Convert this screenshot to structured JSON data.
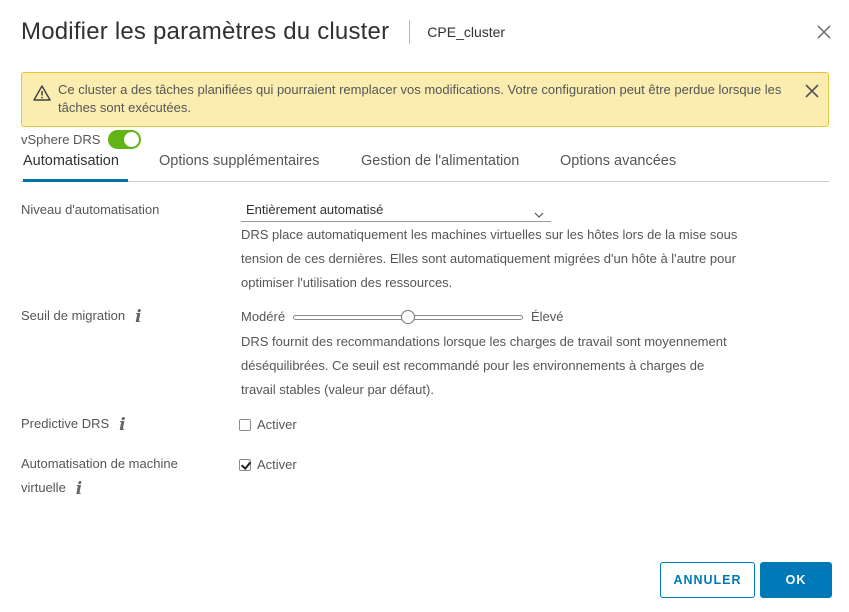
{
  "dialog": {
    "title": "Modifier les paramètres du cluster",
    "subtitle": "CPE_cluster"
  },
  "alert": {
    "message": "Ce cluster a des tâches planifiées qui pourraient remplacer vos modifications. Votre configuration peut être perdue lorsque les tâches sont exécutées."
  },
  "drs": {
    "label": "vSphere DRS",
    "enabled": true
  },
  "tabs": [
    {
      "label": "Automatisation",
      "active": true
    },
    {
      "label": "Options supplémentaires",
      "active": false
    },
    {
      "label": "Gestion de l'alimentation",
      "active": false
    },
    {
      "label": "Options avancées",
      "active": false
    }
  ],
  "form": {
    "automation_level": {
      "label": "Niveau d'automatisation",
      "value": "Entièrement automatisé",
      "description": "DRS place automatiquement les machines virtuelles sur les hôtes lors de la mise sous tension de ces dernières. Elles sont automatiquement migrées d'un hôte à l'autre pour optimiser l'utilisation des ressources."
    },
    "migration_threshold": {
      "label": "Seuil de migration",
      "low_label": "Modéré",
      "high_label": "Élevé",
      "level": 0.5,
      "description": "DRS fournit des recommandations lorsque les charges de travail sont moyennement déséquilibrées. Ce seuil est recommandé pour les environnements à charges de travail stables (valeur par défaut)."
    },
    "predictive_drs": {
      "label": "Predictive DRS",
      "checkbox_label": "Activer",
      "checked": false
    },
    "vm_automation": {
      "label_line1": "Automatisation de machine",
      "label_line2": "virtuelle",
      "checkbox_label": "Activer",
      "checked": true
    }
  },
  "footer": {
    "cancel_label": "ANNULER",
    "ok_label": "OK"
  },
  "colors": {
    "accent": "#0079b8",
    "toggle_on": "#60b515",
    "alert_bg": "#fbecb0",
    "alert_border": "#e8c53e"
  },
  "icons": {
    "close": "close-icon",
    "warning": "warning-icon",
    "info": "info-icon",
    "caret": "chevron-down-icon"
  }
}
